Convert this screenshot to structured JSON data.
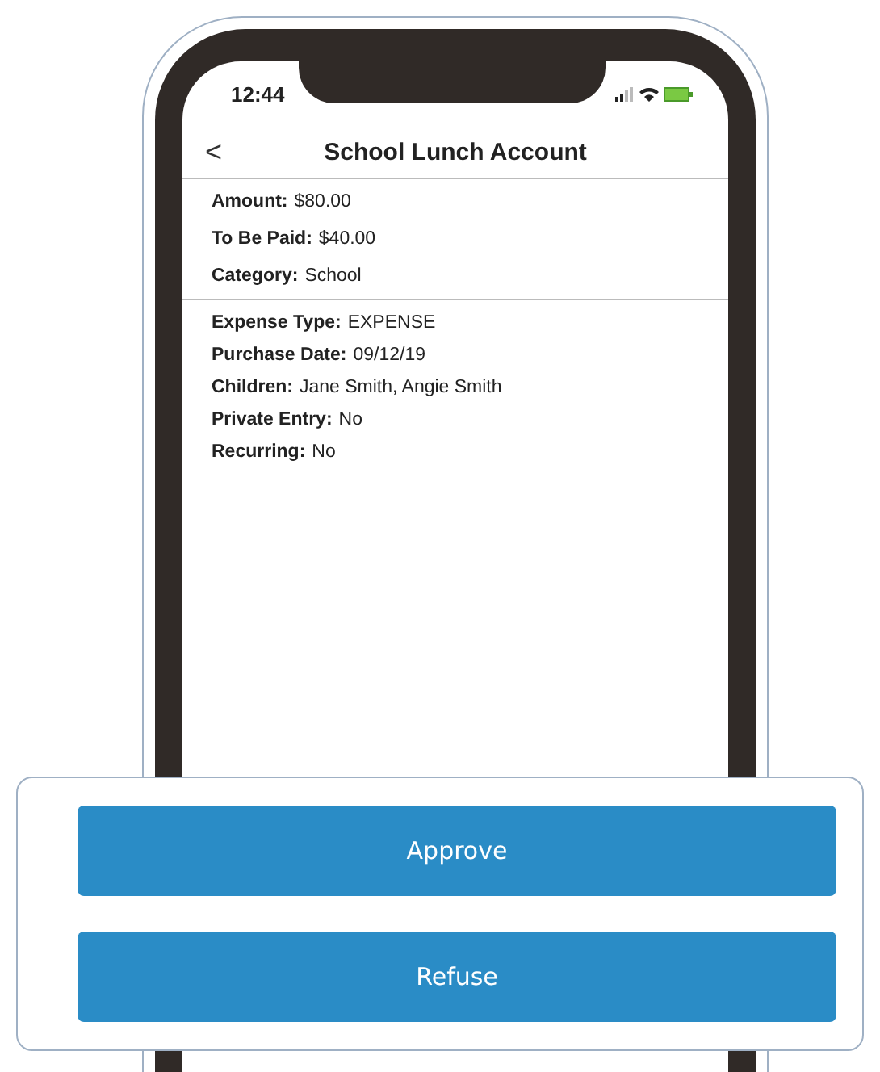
{
  "status_bar": {
    "time": "12:44"
  },
  "header": {
    "back": "<",
    "title": "School Lunch Account"
  },
  "sections": [
    {
      "fields": [
        {
          "label": "Amount:",
          "value": "$80.00"
        },
        {
          "label": "To Be Paid:",
          "value": "$40.00"
        },
        {
          "label": "Category:",
          "value": "School"
        }
      ]
    },
    {
      "fields": [
        {
          "label": "Expense Type:",
          "value": "EXPENSE"
        },
        {
          "label": "Purchase Date:",
          "value": "09/12/19"
        },
        {
          "label": "Children:",
          "value": "Jane Smith, Angie Smith"
        },
        {
          "label": "Private Entry:",
          "value": "No"
        },
        {
          "label": "Recurring:",
          "value": "No"
        }
      ]
    }
  ],
  "actions": [
    {
      "label": "Approve"
    },
    {
      "label": "Refuse"
    }
  ]
}
